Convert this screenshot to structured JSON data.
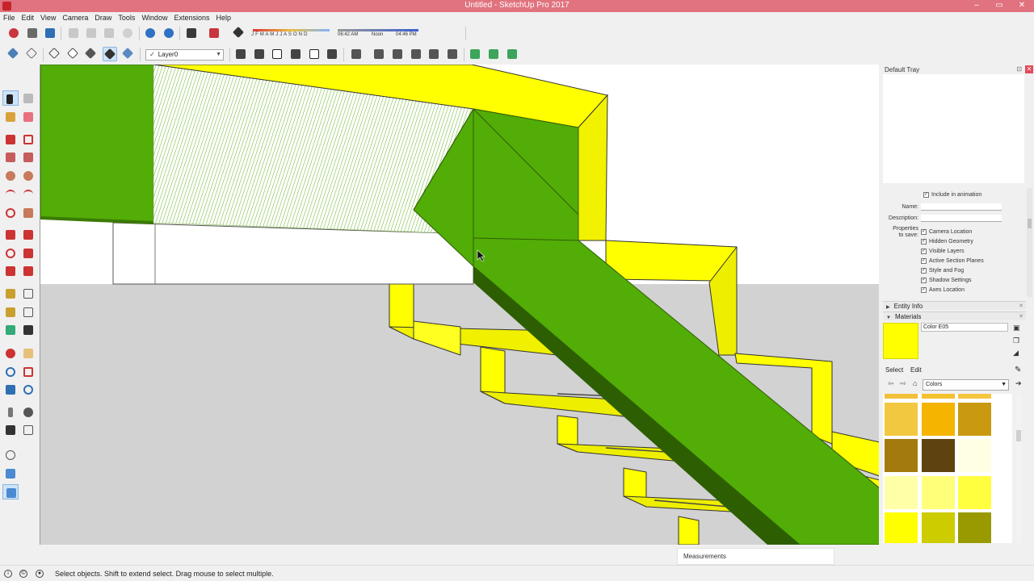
{
  "window": {
    "title": "Untitled - SketchUp Pro 2017",
    "controls": [
      "–",
      "▭",
      "✕"
    ]
  },
  "menu": [
    "File",
    "Edit",
    "View",
    "Camera",
    "Draw",
    "Tools",
    "Window",
    "Extensions",
    "Help"
  ],
  "toolbar": {
    "shadow_months": "J F M A M J J A S O N D",
    "time_start": "06:42 AM",
    "time_noon": "Noon",
    "time_end": "04:46 PM",
    "layer": "Layer0"
  },
  "tray": {
    "title": "Default Tray",
    "scene_props": {
      "include_animation": "Include in animation",
      "name_label": "Name:",
      "description_label": "Description:",
      "properties_label": "Properties\nto save:",
      "properties": [
        "Camera Location",
        "Hidden Geometry",
        "Visible Layers",
        "Active Section Planes",
        "Style and Fog",
        "Shadow Settings",
        "Axes Location"
      ]
    },
    "sections": {
      "entity_info": "Entity Info",
      "materials": "Materials"
    },
    "material": {
      "name": "Color E05",
      "color": "#ffff00",
      "tabs": [
        "Select",
        "Edit"
      ],
      "collection": "Colors"
    },
    "swatches": [
      "#f4c33a",
      "#f2c02a",
      "#f0c438",
      "#f5c644",
      "#f2c840",
      "#f5b400",
      "#c99a10",
      "#a37a0d",
      "#5e4310",
      "#ffffe3",
      "#ffffa8",
      "#ffff7a",
      "#ffff40",
      "#ffff00",
      "#cccc00",
      "#999900"
    ]
  },
  "measurements_label": "Measurements",
  "status_text": "Select objects. Shift to extend select. Drag mouse to select multiple.",
  "colors": {
    "title_bar": "#e0737f",
    "model_green": "#52ad07",
    "model_yellow": "#ffff00",
    "ground": "#d2d2d2"
  }
}
